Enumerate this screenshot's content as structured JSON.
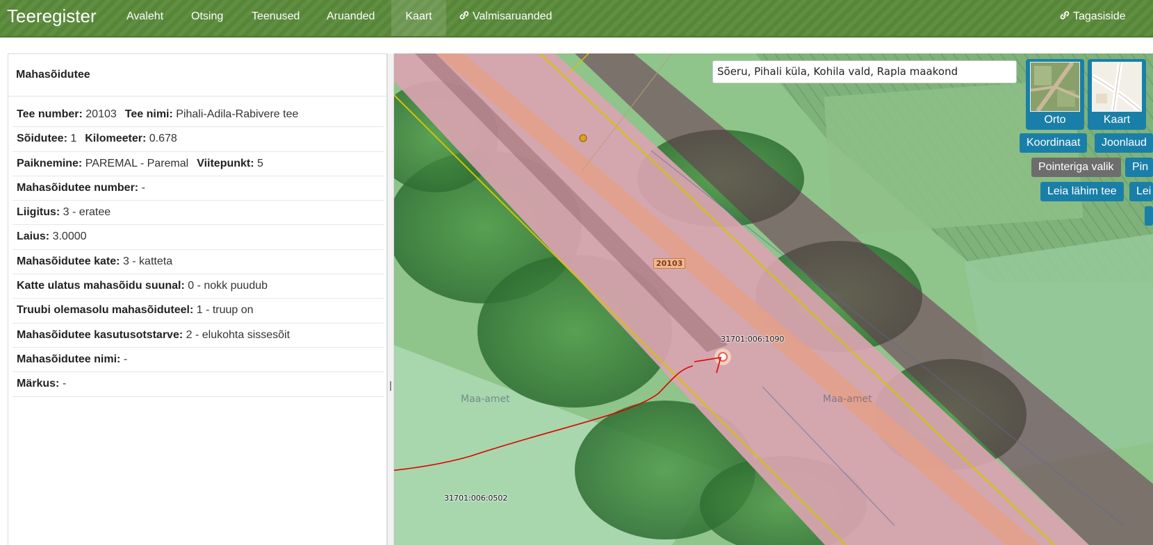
{
  "app": {
    "brand": "Teeregister"
  },
  "nav": {
    "items": [
      "Avaleht",
      "Otsing",
      "Teenused",
      "Aruanded",
      "Kaart"
    ],
    "active": "Kaart",
    "ready_reports": "Valmisaruanded",
    "feedback": "Tagasiside"
  },
  "panel": {
    "title": "Mahasõidutee",
    "rows": [
      {
        "l1": "Tee number:",
        "v1": "20103",
        "l2": "Tee nimi:",
        "v2": "Pihali-Adila-Rabivere tee"
      },
      {
        "l1": "Sõidutee:",
        "v1": "1",
        "l2": "Kilomeeter:",
        "v2": "0.678"
      },
      {
        "l1": "Paiknemine:",
        "v1": "PAREMAL - Paremal",
        "l2": "Viitepunkt:",
        "v2": "5"
      },
      {
        "l1": "Mahasõidutee number:",
        "v1": "-"
      },
      {
        "l1": "Liigitus:",
        "v1": "3 - eratee"
      },
      {
        "l1": "Laius:",
        "v1": "3.0000"
      },
      {
        "l1": "Mahasõidutee kate:",
        "v1": "3 - katteta"
      },
      {
        "l1": "Katte ulatus mahasõidu suunal:",
        "v1": "0 - nokk puudub"
      },
      {
        "l1": "Truubi olemasolu mahasõiduteel:",
        "v1": "1 - truup on"
      },
      {
        "l1": "Mahasõidutee kasutusotstarve:",
        "v1": "2 - elukohta sissesõit"
      },
      {
        "l1": "Mahasõidutee nimi:",
        "v1": "-"
      },
      {
        "l1": "Märkus:",
        "v1": "-"
      }
    ]
  },
  "map": {
    "search_value": "Sõeru, Pihali küla, Kohila vald, Rapla maakond",
    "layers": {
      "orto": "Orto",
      "kaart": "Kaart"
    },
    "buttons": {
      "koordinaat": "Koordinaat",
      "joonlaud": "Joonlaud",
      "pointer_select": "Pointeriga valik",
      "pin": "Pin",
      "nearest_road": "Leia lähim tee",
      "lei": "Lei"
    },
    "labels": {
      "road_number": "20103",
      "parcel_1": "31701:006:1090",
      "parcel_2": "31701:006:0502",
      "watermark_1": "Maa-amet",
      "watermark_2": "Maa-amet"
    }
  },
  "colors": {
    "navbar": "#5a8a3a",
    "map_button": "#1a7fa8",
    "road_area": "#d9a4b0",
    "boundary": "#d4c400",
    "annotation": "#e00000"
  }
}
